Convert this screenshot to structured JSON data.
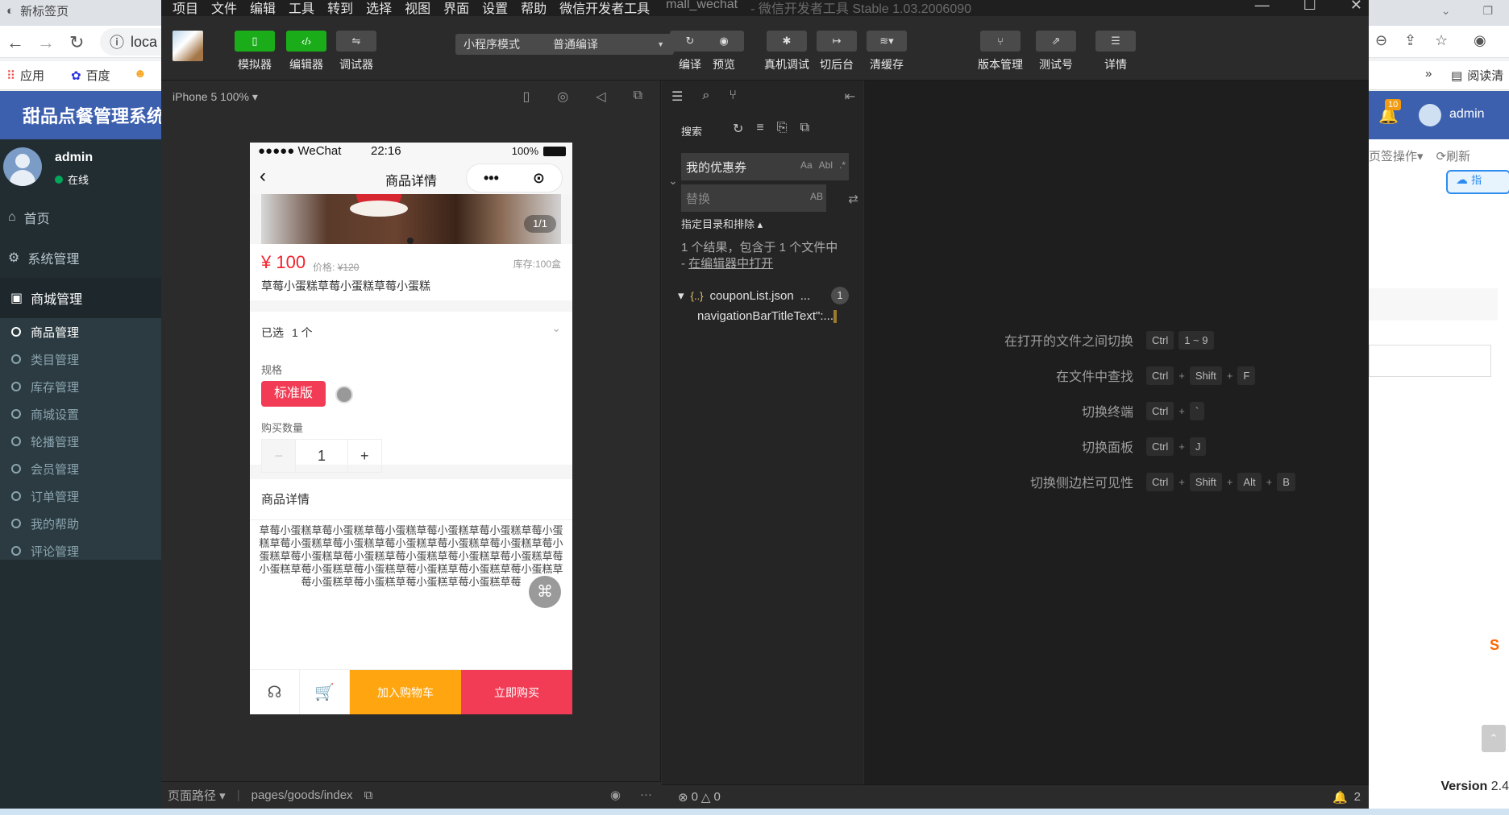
{
  "browser": {
    "tab_title": "新标签页",
    "url_fragment": "loca",
    "bookmarks": [
      "应用",
      "百度"
    ],
    "reading_mode": "阅读清"
  },
  "admin": {
    "system_title": "甜品点餐管理系统",
    "user_name": "admin",
    "user_status": "在线",
    "menu": [
      "首页",
      "系统管理",
      "商城管理"
    ],
    "submenu": [
      "商品管理",
      "类目管理",
      "库存管理",
      "商城设置",
      "轮播管理",
      "会员管理",
      "订单管理",
      "我的帮助",
      "评论管理"
    ],
    "notification_count": "10",
    "top_user": "admin",
    "tab_ops": "页签操作",
    "refresh": "刷新",
    "pill": "指",
    "version_label": "Version",
    "version_value": "2.4"
  },
  "devtools": {
    "menu": [
      "项目",
      "文件",
      "编辑",
      "工具",
      "转到",
      "选择",
      "视图",
      "界面",
      "设置",
      "帮助",
      "微信开发者工具"
    ],
    "project": "mall_wechat",
    "app_version": "- 微信开发者工具 Stable 1.03.2006090",
    "toolbar": {
      "simulator": "模拟器",
      "editor": "编辑器",
      "debugger": "调试器",
      "mode_select": "小程序模式",
      "compile_select": "普通编译",
      "compile": "编译",
      "preview": "预览",
      "remote_debug": "真机调试",
      "background": "切后台",
      "clear_cache": "清缓存",
      "version_mgmt": "版本管理",
      "test_account": "测试号",
      "details": "详情"
    },
    "device": "iPhone 5 100%",
    "footer_path_label": "页面路径",
    "footer_path": "pages/goods/index",
    "search": {
      "title": "搜索",
      "query": "我的优惠券",
      "replace_placeholder": "替换",
      "case_opt": "Aa",
      "word_opt": "Abl",
      "regex_opt": ".*",
      "preserve_case": "AB",
      "include_exclude": "指定目录和排除",
      "result_summary": "1 个结果，包含于 1 个文件中 - ",
      "open_in_editor": "在编辑器中打开",
      "file_name": "couponList.json",
      "file_ellipsis": "...",
      "file_count": "1",
      "match_text": "navigationBarTitleText\":..."
    },
    "shortcuts": [
      {
        "label": "在打开的文件之间切换",
        "keys": [
          "Ctrl",
          "1 ~ 9"
        ]
      },
      {
        "label": "在文件中查找",
        "keys": [
          "Ctrl",
          "Shift",
          "F"
        ]
      },
      {
        "label": "切换终端",
        "keys": [
          "Ctrl",
          "`"
        ]
      },
      {
        "label": "切换面板",
        "keys": [
          "Ctrl",
          "J"
        ]
      },
      {
        "label": "切换侧边栏可见性",
        "keys": [
          "Ctrl",
          "Shift",
          "Alt",
          "B"
        ]
      }
    ],
    "status": {
      "errors": "0",
      "warnings": "0",
      "notifications": "2"
    }
  },
  "phone": {
    "signal": "●●●●● WeChat",
    "time": "22:16",
    "battery": "100%",
    "nav_title": "商品详情",
    "capsule_more": "•••",
    "capsule_close": "⊙",
    "image_counter": "1/1",
    "price": "¥ 100",
    "price_old_label": "价格:",
    "price_old": "¥120",
    "stock": "库存:100盒",
    "goods_name": "草莓小蛋糕草莓小蛋糕草莓小蛋糕",
    "selected_label": "已选",
    "selected_value": "1 个",
    "spec_label": "规格",
    "spec_option": "标准版",
    "qty_label": "购买数量",
    "qty_minus": "−",
    "qty_value": "1",
    "qty_plus": "+",
    "detail_title": "商品详情",
    "detail_text": "草莓小蛋糕草莓小蛋糕草莓小蛋糕草莓小蛋糕草莓小蛋糕草莓小蛋糕草莓小蛋糕草莓小蛋糕草莓小蛋糕草莓小蛋糕草莓小蛋糕草莓小蛋糕草莓小蛋糕草莓小蛋糕草莓小蛋糕草莓小蛋糕草莓小蛋糕草莓小蛋糕草莓小蛋糕草莓小蛋糕草莓小蛋糕草莓小蛋糕草莓小蛋糕草莓小蛋糕草莓小蛋糕草莓小蛋糕草莓小蛋糕草莓",
    "add_cart": "加入购物车",
    "buy_now": "立即购买"
  },
  "colors": {
    "accent_green": "#1aad19",
    "price_red": "#f5222d",
    "buy_red": "#f23c55",
    "cart_orange": "#ffa510",
    "admin_blue": "#3c5fae"
  }
}
